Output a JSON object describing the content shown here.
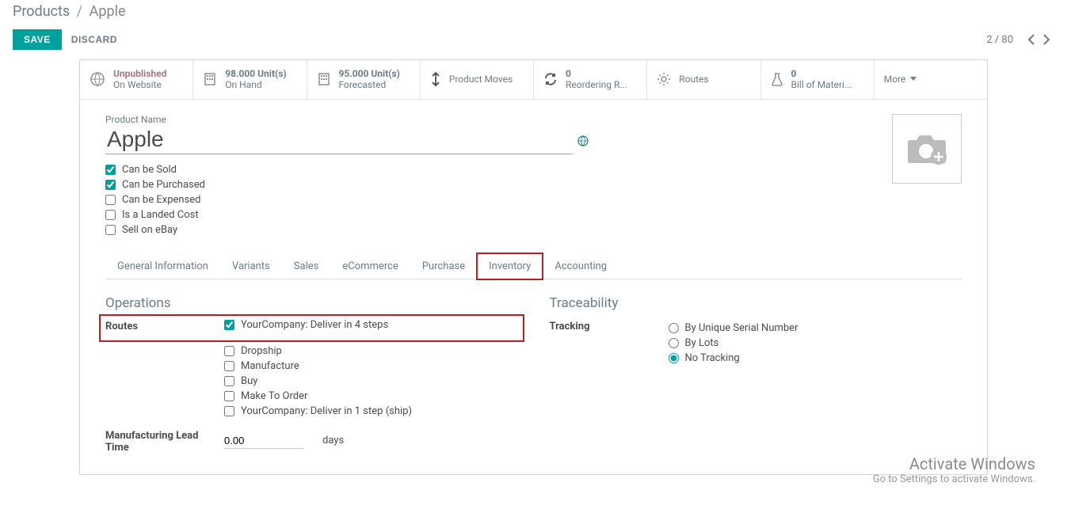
{
  "breadcrumb": {
    "root": "Products",
    "current": "Apple"
  },
  "controls": {
    "save": "SAVE",
    "discard": "DISCARD"
  },
  "pager": {
    "position": "2 / 80"
  },
  "stats": {
    "unpublished": {
      "value": "Unpublished",
      "label": "On Website"
    },
    "onhand": {
      "value": "98.000 Unit(s)",
      "label": "On Hand"
    },
    "forecasted": {
      "value": "95.000 Unit(s)",
      "label": "Forecasted"
    },
    "moves": {
      "label": "Product Moves"
    },
    "reordering": {
      "value": "0",
      "label": "Reordering R..."
    },
    "routes": {
      "label": "Routes"
    },
    "bom": {
      "value": "0",
      "label": "Bill of Materi..."
    },
    "more": {
      "label": "More"
    }
  },
  "product": {
    "name_label": "Product Name",
    "name": "Apple"
  },
  "checks": {
    "sold": {
      "label": "Can be Sold",
      "checked": true
    },
    "purchased": {
      "label": "Can be Purchased",
      "checked": true
    },
    "expensed": {
      "label": "Can be Expensed",
      "checked": false
    },
    "landed": {
      "label": "Is a Landed Cost",
      "checked": false
    },
    "ebay": {
      "label": "Sell on eBay",
      "checked": false
    }
  },
  "tabs": {
    "general": "General Information",
    "variants": "Variants",
    "sales": "Sales",
    "ecommerce": "eCommerce",
    "purchase": "Purchase",
    "inventory": "Inventory",
    "accounting": "Accounting"
  },
  "operations": {
    "title": "Operations",
    "routes_label": "Routes",
    "routes": {
      "r0": {
        "label": "YourCompany: Deliver in 4 steps",
        "checked": true
      },
      "r1": {
        "label": "Dropship",
        "checked": false
      },
      "r2": {
        "label": "Manufacture",
        "checked": false
      },
      "r3": {
        "label": "Buy",
        "checked": false
      },
      "r4": {
        "label": "Make To Order",
        "checked": false
      },
      "r5": {
        "label": "YourCompany: Deliver in 1 step (ship)",
        "checked": false
      }
    },
    "mfg_label": "Manufacturing Lead Time",
    "mfg_value": "0.00",
    "mfg_unit": "days"
  },
  "traceability": {
    "title": "Traceability",
    "tracking_label": "Tracking",
    "options": {
      "t0": {
        "label": "By Unique Serial Number",
        "selected": false
      },
      "t1": {
        "label": "By Lots",
        "selected": false
      },
      "t2": {
        "label": "No Tracking",
        "selected": true
      }
    }
  },
  "watermark": {
    "line1": "Activate Windows",
    "line2": "Go to Settings to activate Windows."
  }
}
